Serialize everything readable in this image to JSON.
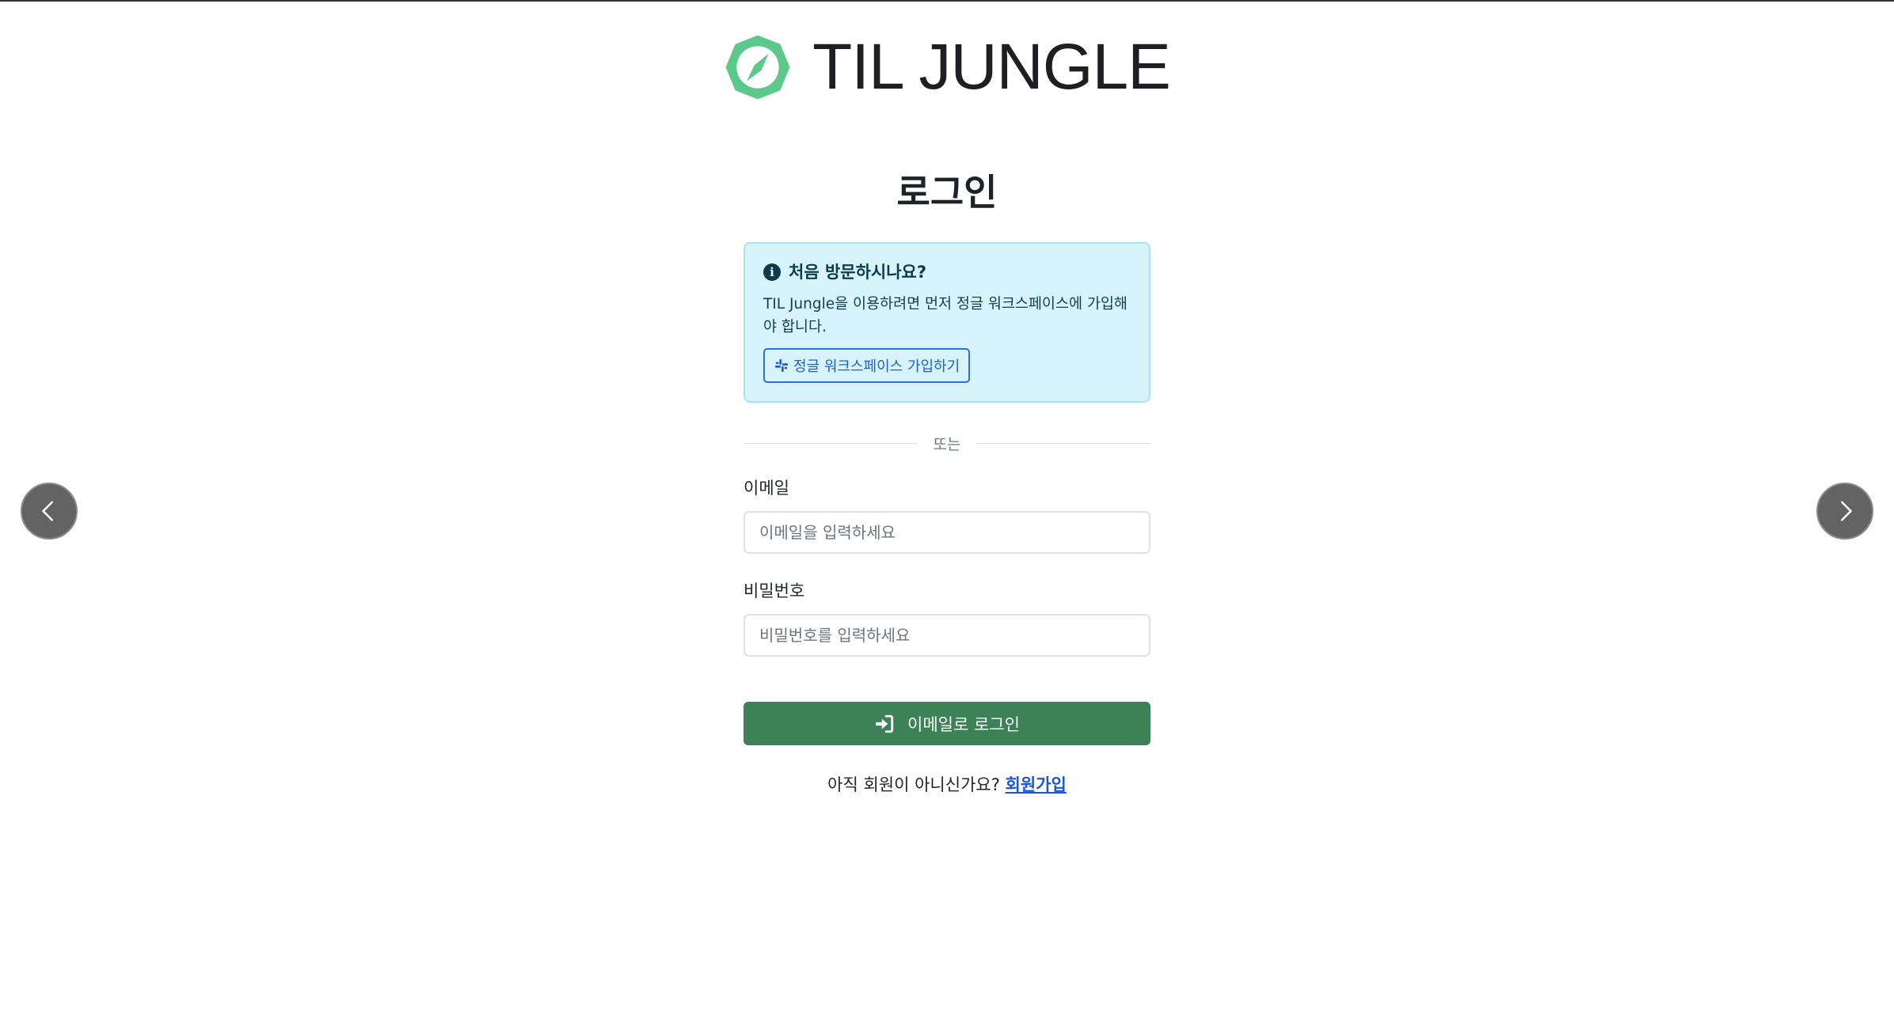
{
  "brand": {
    "name": "TIL JUNGLE",
    "accent_color": "#5cc98a"
  },
  "page": {
    "title": "로그인"
  },
  "info_box": {
    "heading": "처음 방문하시나요?",
    "text": "TIL Jungle을 이용하려면 먼저 정글 워크스페이스에 가입해야 합니다.",
    "button_label": "정글 워크스페이스 가입하기",
    "icon": "info-icon",
    "button_icon": "slack-icon"
  },
  "divider": {
    "text": "또는"
  },
  "form": {
    "email_label": "이메일",
    "email_placeholder": "이메일을 입력하세요",
    "email_value": "",
    "password_label": "비밀번호",
    "password_placeholder": "비밀번호를 입력하세요",
    "password_value": "",
    "submit_label": "이메일로 로그인",
    "submit_icon": "sign-in-icon",
    "submit_color": "#3d8156"
  },
  "signup": {
    "prompt": "아직 회원이 아니신가요?",
    "link_label": "회원가입"
  },
  "carousel": {
    "prev_icon": "chevron-left-icon",
    "next_icon": "chevron-right-icon"
  }
}
